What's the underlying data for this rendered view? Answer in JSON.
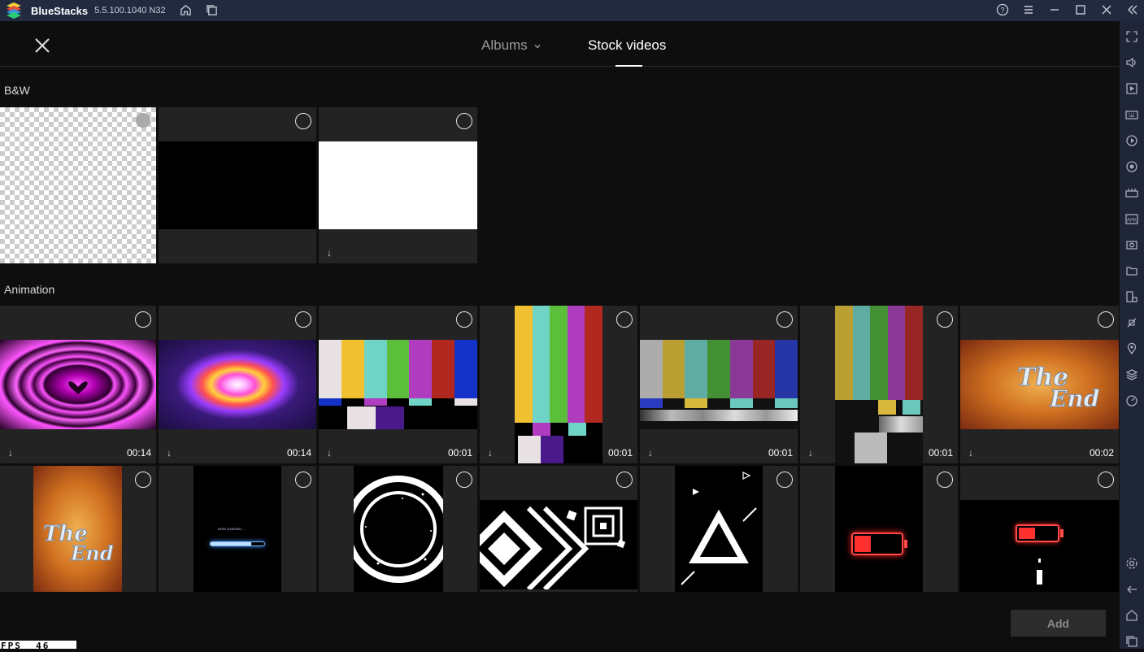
{
  "titlebar": {
    "app_name": "BlueStacks",
    "version": "5.5.100.1040 N32",
    "icons": [
      "home-icon",
      "multi-instance-icon",
      "help-icon",
      "menu-icon",
      "minimize-icon",
      "maximize-icon",
      "close-icon",
      "collapse-sidebar-icon"
    ]
  },
  "header": {
    "tabs": [
      {
        "label": "Albums",
        "active": false
      },
      {
        "label": "Stock videos",
        "active": true
      }
    ]
  },
  "sections": [
    {
      "title": "B&W"
    },
    {
      "title": "Animation"
    }
  ],
  "bw_tiles": [
    {
      "kind": "transparent"
    },
    {
      "kind": "black"
    },
    {
      "kind": "white"
    }
  ],
  "animation_row1": [
    {
      "duration": "00:14",
      "kind": "pink-heart"
    },
    {
      "duration": "00:14",
      "kind": "rainbow-heart"
    },
    {
      "duration": "00:01",
      "kind": "color-bars"
    },
    {
      "duration": "00:01",
      "kind": "color-bars-vertical"
    },
    {
      "duration": "00:01",
      "kind": "color-bars-noisy"
    },
    {
      "duration": "00:01",
      "kind": "color-bars-vertical-noisy"
    },
    {
      "duration": "00:02",
      "kind": "the-end"
    }
  ],
  "animation_row2": [
    {
      "kind": "the-end-vertical"
    },
    {
      "kind": "loading-bar",
      "text": "NOW LOADING ..."
    },
    {
      "kind": "circle-ring"
    },
    {
      "kind": "geometric"
    },
    {
      "kind": "triangle"
    },
    {
      "kind": "battery-low"
    },
    {
      "kind": "battery-charging"
    }
  ],
  "footer": {
    "add_label": "Add",
    "fps_label": "FPS",
    "fps_value": "46"
  },
  "colors": {
    "titlebar": "#222a40",
    "sidebar": "#1f2638",
    "background": "#0e0e0e",
    "tile": "#232323"
  }
}
